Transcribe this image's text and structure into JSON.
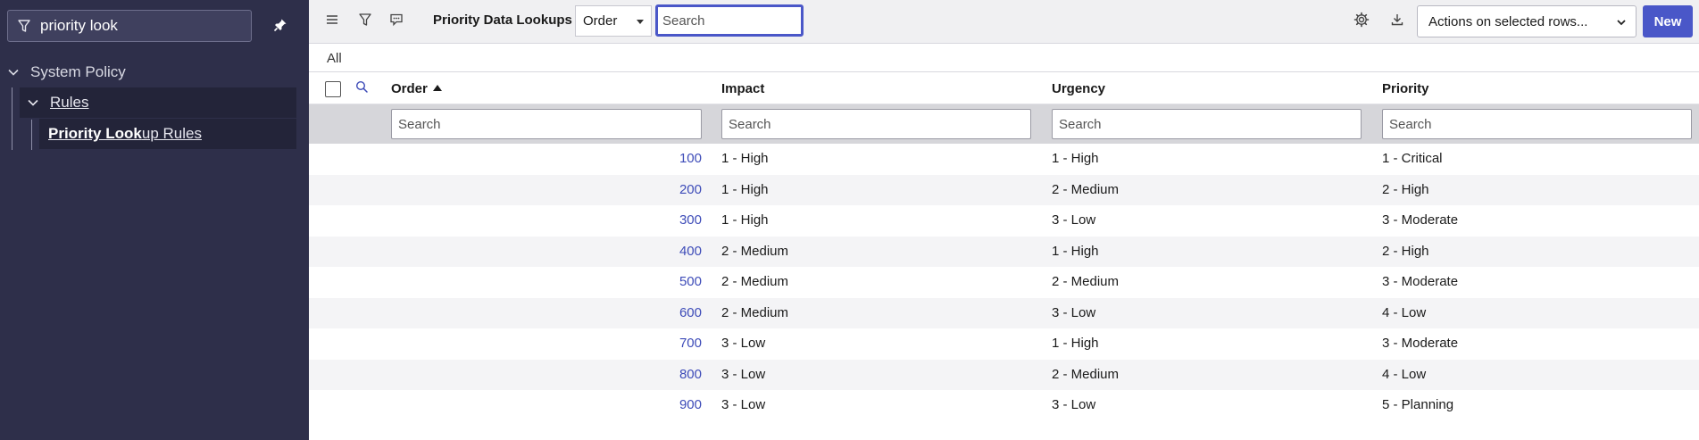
{
  "sidebar": {
    "filter_value": "priority look",
    "nav": {
      "level0_label": "System Policy",
      "level1_label": "Rules",
      "level2_bold": "Priority Look",
      "level2_rest": "up Rules"
    }
  },
  "toolbar": {
    "title": "Priority Data Lookups",
    "field_select": "Order",
    "search_placeholder": "Search",
    "actions_label": "Actions on selected rows...",
    "new_label": "New"
  },
  "breadcrumb": {
    "label": "All"
  },
  "table": {
    "columns": [
      "Order",
      "Impact",
      "Urgency",
      "Priority"
    ],
    "search_placeholder": "Search",
    "rows": [
      {
        "order": "100",
        "impact": "1 - High",
        "urgency": "1 - High",
        "priority": "1 - Critical"
      },
      {
        "order": "200",
        "impact": "1 - High",
        "urgency": "2 - Medium",
        "priority": "2 - High"
      },
      {
        "order": "300",
        "impact": "1 - High",
        "urgency": "3 - Low",
        "priority": "3 - Moderate"
      },
      {
        "order": "400",
        "impact": "2 - Medium",
        "urgency": "1 - High",
        "priority": "2 - High"
      },
      {
        "order": "500",
        "impact": "2 - Medium",
        "urgency": "2 - Medium",
        "priority": "3 - Moderate"
      },
      {
        "order": "600",
        "impact": "2 - Medium",
        "urgency": "3 - Low",
        "priority": "4 - Low"
      },
      {
        "order": "700",
        "impact": "3 - Low",
        "urgency": "1 - High",
        "priority": "3 - Moderate"
      },
      {
        "order": "800",
        "impact": "3 - Low",
        "urgency": "2 - Medium",
        "priority": "4 - Low"
      },
      {
        "order": "900",
        "impact": "3 - Low",
        "urgency": "3 - Low",
        "priority": "5 - Planning"
      }
    ]
  },
  "colors": {
    "accent": "#4a57c8",
    "sidebar_bg": "#2e2f4a",
    "link": "#3d4bb8"
  },
  "icons": {
    "filter": "filter-icon",
    "pin": "pin-icon",
    "menu": "hamburger-icon",
    "chevron": "chevron-down-icon",
    "search": "search-icon",
    "gear": "gear-icon",
    "download": "download-icon"
  }
}
